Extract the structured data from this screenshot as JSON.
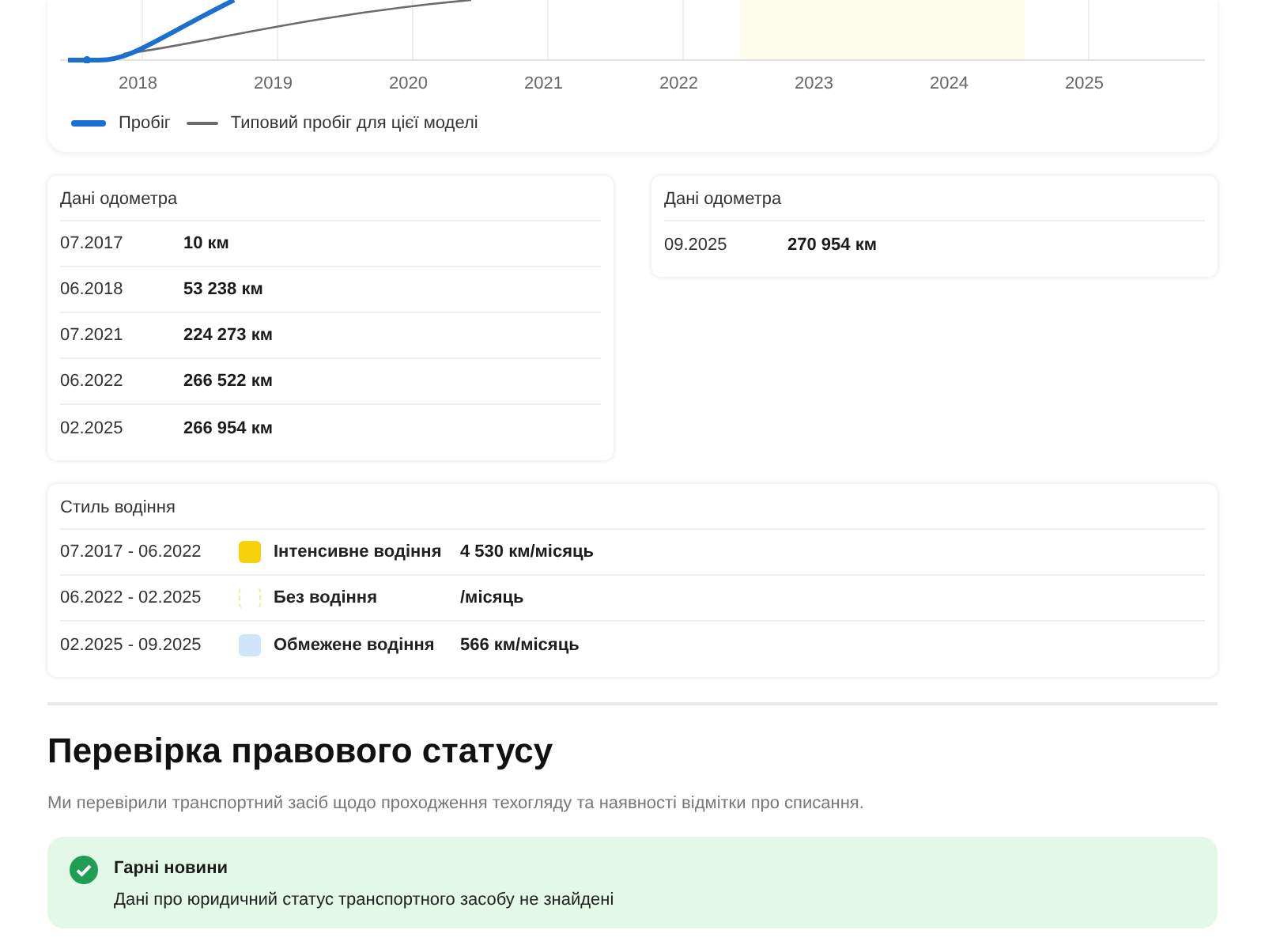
{
  "mileage_chart": {
    "x_labels": [
      "2018",
      "2019",
      "2020",
      "2021",
      "2022",
      "2023",
      "2024",
      "2025"
    ],
    "legend": [
      {
        "label": "Пробіг",
        "color": "#1a6fd1",
        "kind": "thick"
      },
      {
        "label": "Типовий пробіг для цієї моделі",
        "color": "#6b6b6b",
        "kind": "thin"
      }
    ]
  },
  "odometer_cards": [
    {
      "title": "Дані одометра",
      "rows": [
        {
          "date": "07.2017",
          "value": "10 км"
        },
        {
          "date": "06.2018",
          "value": "53 238 км"
        },
        {
          "date": "07.2021",
          "value": "224 273 км"
        },
        {
          "date": "06.2022",
          "value": "266 522 км"
        },
        {
          "date": "02.2025",
          "value": "266 954 км"
        }
      ]
    },
    {
      "title": "Дані одометра",
      "rows": [
        {
          "date": "09.2025",
          "value": "270 954 км"
        }
      ]
    }
  ],
  "driving_style": {
    "title": "Стиль водіння",
    "rows": [
      {
        "period": "07.2017 - 06.2022",
        "kind": "filled",
        "color": "#f5d20c",
        "label": "Інтенсивне водіння",
        "rate": "4 530 км/місяць"
      },
      {
        "period": "06.2022 - 02.2025",
        "kind": "dashed",
        "color": "#e6ef9a",
        "label": "Без водіння",
        "rate": "/місяць"
      },
      {
        "period": "02.2025 - 09.2025",
        "kind": "filled",
        "color": "#cfe6fa",
        "label": "Обмежене водіння",
        "rate": "566 км/місяць"
      }
    ]
  },
  "legal_status": {
    "title": "Перевірка правового статусу",
    "description": "Ми перевірили транспортний засіб щодо проходження техогляду та наявності відмітки про списання.",
    "notice": {
      "kind": "success",
      "title": "Гарні новини",
      "text": "Дані про юридичний статус транспортного засобу не знайдені"
    }
  }
}
